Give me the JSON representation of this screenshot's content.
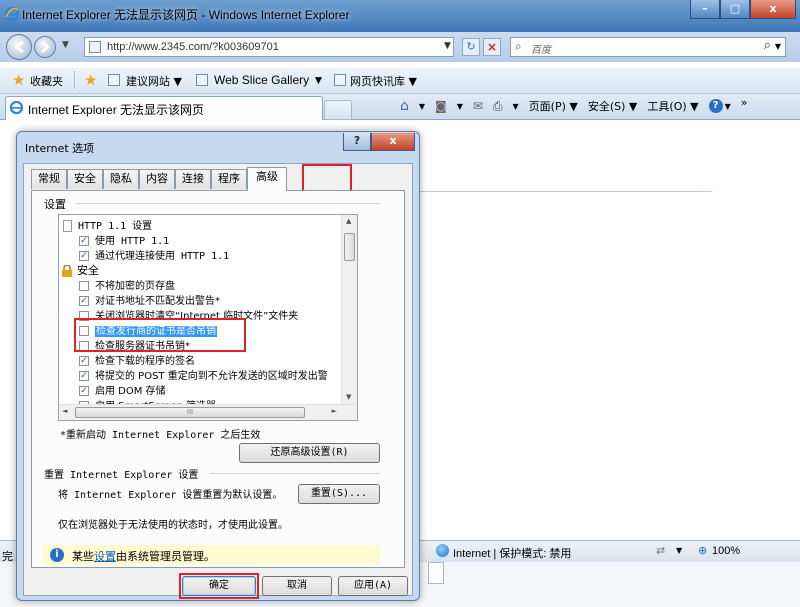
{
  "window": {
    "title": "Internet Explorer 无法显示该网页 - Windows Internet Explorer",
    "controls": {
      "minimize": "–",
      "maximize": "□",
      "close": "x"
    }
  },
  "address_bar": {
    "url": "http://www.2345.com/?k003609701",
    "search_placeholder": "百度"
  },
  "favorites_bar": {
    "favorites_label": "收藏夹",
    "items": [
      "建议网站 ▼",
      "Web Slice Gallery ▼",
      "网页快讯库 ▼"
    ]
  },
  "tab": {
    "title": "Internet Explorer 无法显示该网页"
  },
  "command_bar": {
    "page": "页面(P) ▼",
    "safety": "安全(S) ▼",
    "tools": "工具(O) ▼",
    "help_arrow": "▼",
    "more": "»"
  },
  "status_bar": {
    "zone": "Internet | 保护模式: 禁用",
    "zoom": "100%"
  },
  "taskbar": {
    "left_char": "完"
  },
  "dialog": {
    "title": "Internet 选项",
    "help_button": "?",
    "close_button": "x",
    "tabs": [
      "常规",
      "安全",
      "隐私",
      "内容",
      "连接",
      "程序",
      "高级"
    ],
    "active_tab": "高级",
    "settings_label": "设置",
    "tree_items": [
      {
        "label": "HTTP 1.1 设置",
        "kind": "folder"
      },
      {
        "label": "使用 HTTP 1.1",
        "kind": "check",
        "checked": true
      },
      {
        "label": "通过代理连接使用 HTTP 1.1",
        "kind": "check",
        "checked": true
      },
      {
        "label": "安全",
        "kind": "lock"
      },
      {
        "label": "不将加密的页存盘",
        "kind": "check",
        "checked": false
      },
      {
        "label": "对证书地址不匹配发出警告*",
        "kind": "check",
        "checked": true
      },
      {
        "label": "关闭浏览器时清空“Internet 临时文件”文件夹",
        "kind": "check",
        "checked": false
      },
      {
        "label": "检查发行商的证书是否吊销",
        "kind": "check",
        "checked": false,
        "selected": true
      },
      {
        "label": "检查服务器证书吊销*",
        "kind": "check",
        "checked": false
      },
      {
        "label": "检查下载的程序的签名",
        "kind": "check",
        "checked": true
      },
      {
        "label": "将提交的 POST 重定向到不允许发送的区域时发出警",
        "kind": "check",
        "checked": true
      },
      {
        "label": "启用 DOM 存储",
        "kind": "check",
        "checked": true
      },
      {
        "label": "启用 SmartScreen 筛选器",
        "kind": "check",
        "checked": false
      }
    ],
    "hscroll_grip": "III",
    "restart_note": "*重新启动 Internet Explorer 之后生效",
    "restore_button": "还原高级设置(R)",
    "reset_group": "重置 Internet Explorer 设置",
    "reset_desc": "将 Internet Explorer 设置重置为默认设置。",
    "reset_button": "重置(S)...",
    "reset_note": "仅在浏览器处于无法使用的状态时，才使用此设置。",
    "admin_note_prefix": "某些",
    "admin_note_link": "设置",
    "admin_note_suffix": "由系统管理员管理。",
    "ok_button": "确定",
    "cancel_button": "取消",
    "apply_button": "应用(A)"
  },
  "colors": {
    "highlight": "#e0202a",
    "selection": "#3399ff",
    "link": "#0b57d0"
  }
}
